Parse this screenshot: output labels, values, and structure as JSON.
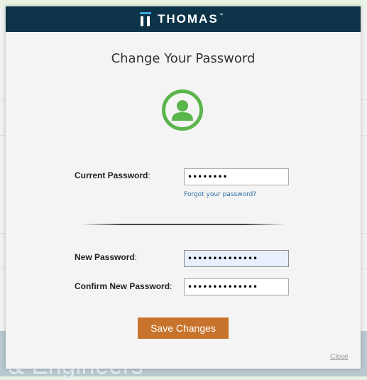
{
  "brand": {
    "name": "THOMAS",
    "tm": "™"
  },
  "dialog": {
    "title": "Change Your Password",
    "current_password_label": "Current Password",
    "current_password_value": "••••••••",
    "forgot_link": "Forgot your password?",
    "new_password_label": "New Password",
    "new_password_value": "••••••••••••••",
    "confirm_password_label": "Confirm New Password",
    "confirm_password_value": "••••••••••••••",
    "colon": ":",
    "save_label": "Save Changes",
    "close_label": "Close"
  },
  "background": {
    "band_text": "s & Engineers"
  },
  "colors": {
    "header_bg": "#0d3348",
    "accent_blue": "#3da8e0",
    "user_icon_green": "#5ab54a",
    "save_button": "#c8732b",
    "link_blue": "#2a6ea6"
  },
  "icons": {
    "user": "user-circle-icon",
    "logo": "thomas-logo-icon"
  }
}
